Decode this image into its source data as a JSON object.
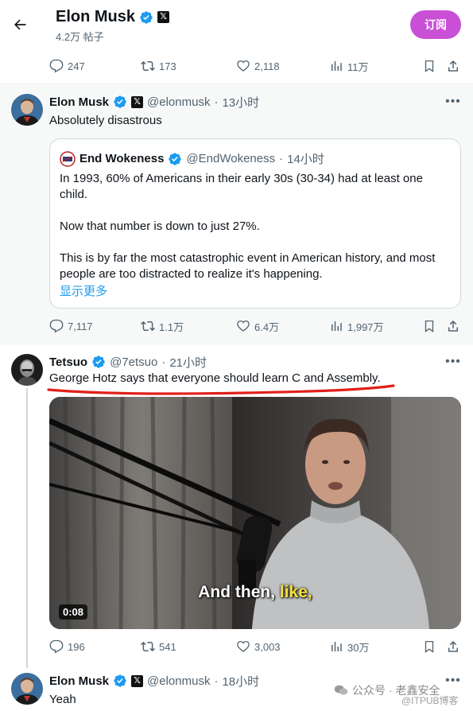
{
  "header": {
    "title": "Elon Musk",
    "subtitle": "4.2万 帖子",
    "subscribe_label": "订阅",
    "x_badge": "𝕏"
  },
  "prev_tweet": {
    "cut_text": "…y …… …… …",
    "stats": {
      "replies": "247",
      "reposts": "173",
      "likes": "2,118",
      "views": "11万"
    }
  },
  "tweet1": {
    "name": "Elon Musk",
    "handle": "@elonmusk",
    "time": "13小时",
    "text": "Absolutely disastrous",
    "quote": {
      "name": "End Wokeness",
      "handle": "@EndWokeness",
      "time": "14小时",
      "para1_line1": "In 1993, 60% of Americans in their early 30s (30-34) had at least one",
      "para1_line2": "child.",
      "para2": "Now that number is down to just 27%.",
      "para3_line1": "This is by far the most catastrophic event in American history, and most",
      "para3_line2": "people are too distracted to realize it's happening.",
      "show_more": "显示更多"
    },
    "stats": {
      "replies": "7,117",
      "reposts": "1.1万",
      "likes": "6.4万",
      "views": "1,997万"
    }
  },
  "tweet2": {
    "name": "Tetsuo",
    "handle": "@7etsuo",
    "time": "21小时",
    "text": "George Hotz says that everyone should learn C and Assembly.",
    "video": {
      "duration": "0:08",
      "caption_a": "And then, ",
      "caption_b": "like,"
    },
    "stats": {
      "replies": "196",
      "reposts": "541",
      "likes": "3,003",
      "views": "30万"
    }
  },
  "tweet3": {
    "name": "Elon Musk",
    "handle": "@elonmusk",
    "time": "18小时",
    "text": "Yeah"
  },
  "watermark": {
    "text": "公众号 · 老鑫安全",
    "sub": "@ITPUB博客"
  },
  "colors": {
    "accent": "#1d9bf0",
    "subscribe": "#c94fd6",
    "annotation": "#e0201b",
    "verified": "#1d9bf0"
  }
}
